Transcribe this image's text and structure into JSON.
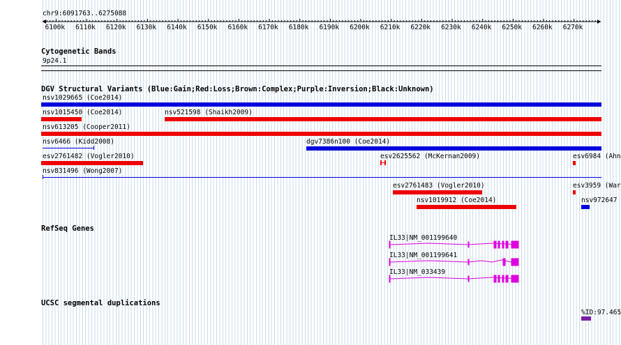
{
  "position": "chr9:6091763..6275088",
  "ruler": {
    "ticks": [
      "6100k",
      "6110k",
      "6120k",
      "6130k",
      "6140k",
      "6150k",
      "6160k",
      "6170k",
      "6180k",
      "6190k",
      "6200k",
      "6210k",
      "6220k",
      "6230k",
      "6240k",
      "6250k",
      "6260k",
      "6270k"
    ]
  },
  "cytoband": {
    "title": "Cytogenetic Bands",
    "band": "9p24.1"
  },
  "dgv": {
    "title": "DGV Structural Variants (Blue:Gain;Red:Loss;Brown:Complex;Purple:Inversion;Black:Unknown)",
    "colors": {
      "gain": "#0000dd",
      "loss": "#ee0000"
    },
    "variants": [
      {
        "label": "nsv1029665 (Coe2014)",
        "type": "gain"
      },
      {
        "label": "nsv1015450 (Coe2014)",
        "type": "loss"
      },
      {
        "label": "nsv521598 (Shaikh2009)",
        "type": "loss"
      },
      {
        "label": "nsv613205 (Cooper2011)",
        "type": "loss"
      },
      {
        "label": "nsv6466 (Kidd2008)",
        "type": "gain"
      },
      {
        "label": "dgv7386n100 (Coe2014)",
        "type": "gain"
      },
      {
        "label": "esv2761482 (Vogler2010)",
        "type": "loss"
      },
      {
        "label": "esv2625562 (McKernan2009)",
        "type": "loss"
      },
      {
        "label": "esv6984 (Ahn",
        "type": "loss"
      },
      {
        "label": "nsv831496 (Wong2007)",
        "type": "gain"
      },
      {
        "label": "esv2761483 (Vogler2010)",
        "type": "loss"
      },
      {
        "label": "esv3959 (War",
        "type": "loss"
      },
      {
        "label": "nsv1019912 (Coe2014)",
        "type": "loss"
      },
      {
        "label": "nsv972647",
        "type": "gain"
      }
    ]
  },
  "refseq": {
    "title": "RefSeq Genes",
    "color": "#dd00dd",
    "genes": [
      {
        "label": "IL33|NM_001199640"
      },
      {
        "label": "IL33|NM_001199641"
      },
      {
        "label": "IL33|NM_033439"
      }
    ]
  },
  "segdup": {
    "title": "UCSC segmental duplications",
    "label": "%ID:97.465",
    "color": "#7a1fa0"
  }
}
